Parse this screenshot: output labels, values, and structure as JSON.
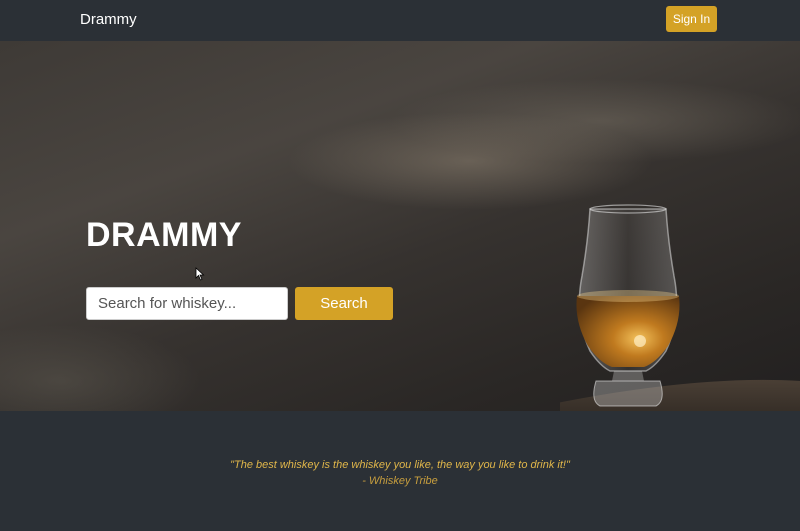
{
  "navbar": {
    "brand": "Drammy",
    "signin_label": "Sign In"
  },
  "hero": {
    "title": "DRAMMY",
    "search": {
      "placeholder": "Search for whiskey...",
      "value": ""
    },
    "search_button_label": "Search"
  },
  "footer": {
    "quote": "\"The best whiskey is the whiskey you like, the way you like to drink it!\"",
    "attribution": "- Whiskey Tribe"
  },
  "colors": {
    "accent": "#d4a226",
    "background": "#2b3036",
    "quote": "#e0b64a"
  },
  "icons": {
    "hero_image": "whiskey-glass-image",
    "cursor": "mouse-pointer-icon"
  }
}
